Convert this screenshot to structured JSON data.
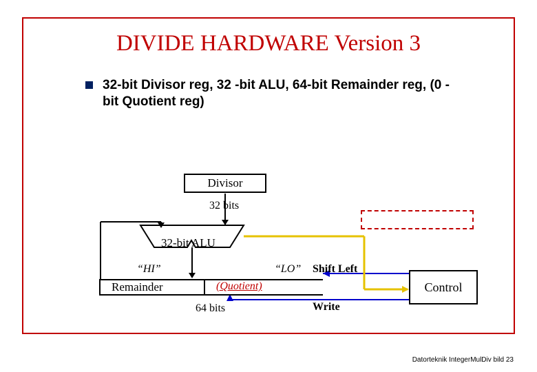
{
  "title": "DIVIDE HARDWARE Version 3",
  "bullet": "32-bit Divisor reg, 32 -bit ALU, 64-bit Remainder reg,  (0 -bit Quotient reg)",
  "divisor_label": "Divisor",
  "bits32_label": "32 bits",
  "alu_label": "32-bit ALU",
  "hi_label": "“HI”",
  "lo_label": "“LO”",
  "remainder_label": "Remainder",
  "quotient_label": "(Quotient)",
  "bits64_label": "64 bits",
  "shift_left_label": "Shift Left",
  "write_label": "Write",
  "control_label": "Control",
  "footer": "Datorteknik IntegerMulDiv bild 23"
}
